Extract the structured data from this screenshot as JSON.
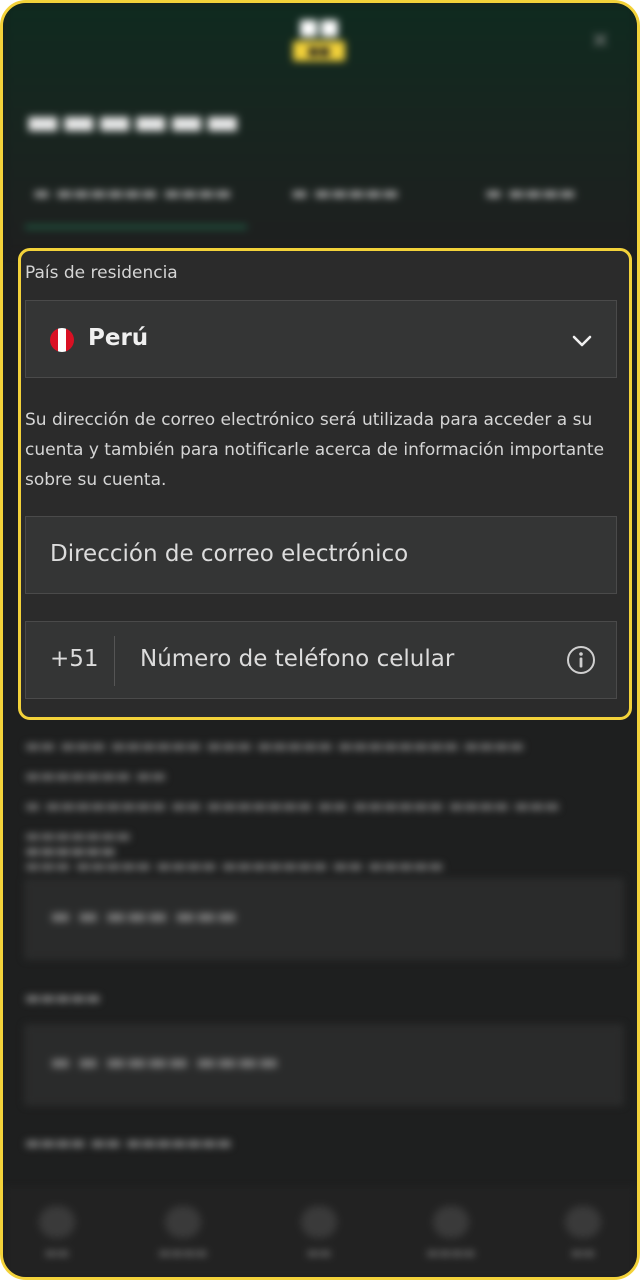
{
  "form": {
    "residence_label": "País de residencia",
    "country_value": "Perú",
    "email_notice": "Su dirección de correo electrónico será utilizada para acceder a su cuenta y también para notificarle acerca de información importante sobre su cuenta.",
    "email_placeholder": "Dirección de correo electrónico",
    "phone_prefix": "+51",
    "phone_placeholder": "Número de teléfono celular"
  },
  "icons": {
    "country_flag": "peru-flag-icon",
    "dropdown": "chevron-down-icon",
    "phone_info": "info-icon"
  },
  "colors": {
    "highlight": "#f3d23a",
    "background": "#1e1f1f",
    "field": "#343535",
    "flag_red": "#d91023"
  }
}
